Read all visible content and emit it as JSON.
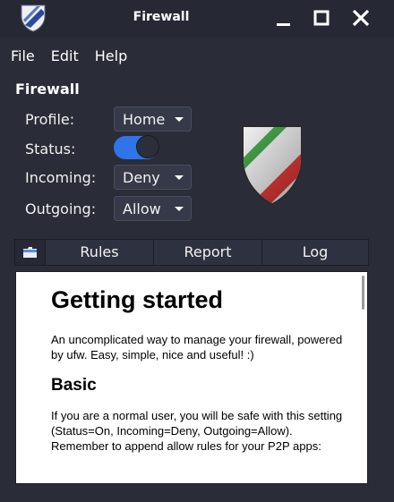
{
  "window": {
    "title": "Firewall",
    "app_icon": "shield-icon",
    "controls": [
      "minimize-icon",
      "maximize-icon",
      "close-icon"
    ]
  },
  "menubar": {
    "items": [
      "File",
      "Edit",
      "Help"
    ]
  },
  "settings": {
    "section_title": "Firewall",
    "profile": {
      "label": "Profile:",
      "value": "Home"
    },
    "status": {
      "label": "Status:",
      "enabled": true
    },
    "incoming": {
      "label": "Incoming:",
      "value": "Deny"
    },
    "outgoing": {
      "label": "Outgoing:",
      "value": "Allow"
    }
  },
  "tabs": {
    "icon": "folder-icon",
    "items": [
      "Rules",
      "Report",
      "Log"
    ]
  },
  "doc": {
    "heading": "Getting started",
    "intro": "An uncomplicated way to manage your firewall, powered by ufw. Easy, simple, nice and useful! :)",
    "subheading": "Basic",
    "basic_text": "If you are a normal user, you will be safe with this setting (Status=On, Incoming=Deny, Outgoing=Allow). Remember to append allow rules for your P2P apps:"
  },
  "colors": {
    "background": "#2a2d38",
    "accent": "#2f74e8",
    "shield_green": "#2e8b3a",
    "shield_red": "#c0282e"
  }
}
